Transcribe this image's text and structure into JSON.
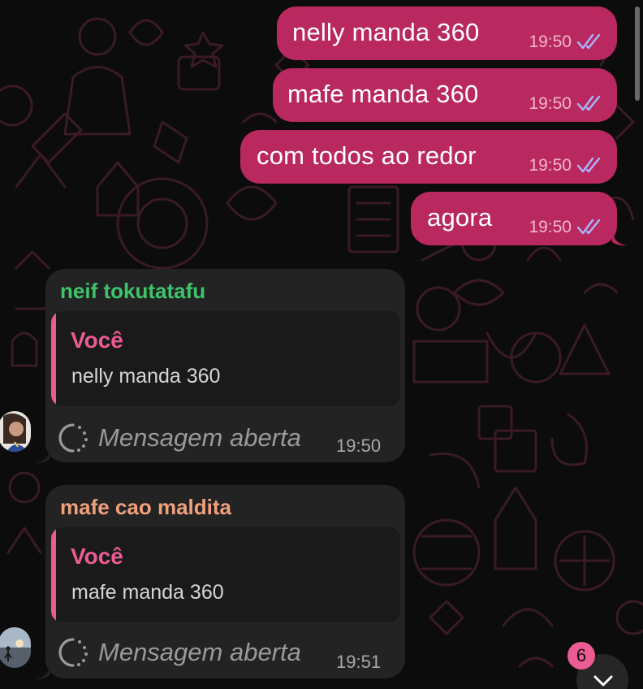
{
  "outgoing": [
    {
      "text": "nelly manda 360",
      "time": "19:50",
      "status": "read"
    },
    {
      "text": "mafe manda 360",
      "time": "19:50",
      "status": "read"
    },
    {
      "text": "com todos ao redor",
      "time": "19:50",
      "status": "read"
    },
    {
      "text": "agora",
      "time": "19:50",
      "status": "read"
    }
  ],
  "incoming": [
    {
      "sender": "neif tokutatafu",
      "sender_color": "#3fc46b",
      "quote": {
        "author": "Você",
        "text": "nelly manda 360"
      },
      "status_text": "Mensagem aberta",
      "time": "19:50",
      "avatar": "avatar-person"
    },
    {
      "sender": "mafe cao maldita",
      "sender_color": "#f0a07c",
      "quote": {
        "author": "Você",
        "text": "mafe manda 360"
      },
      "status_text": "Mensagem aberta",
      "time": "19:51",
      "avatar": "avatar-beach"
    }
  ],
  "scroll_down": {
    "unread_count": "6",
    "icon": "chevron-down-icon"
  },
  "colors": {
    "outgoing_bubble": "#b9295f",
    "incoming_bubble": "#232323",
    "quote_accent": "#ec5c93",
    "background": "#0c0c0c"
  },
  "icons": {
    "read_receipt": "double-check-icon",
    "view_once_opened": "view-once-icon"
  }
}
